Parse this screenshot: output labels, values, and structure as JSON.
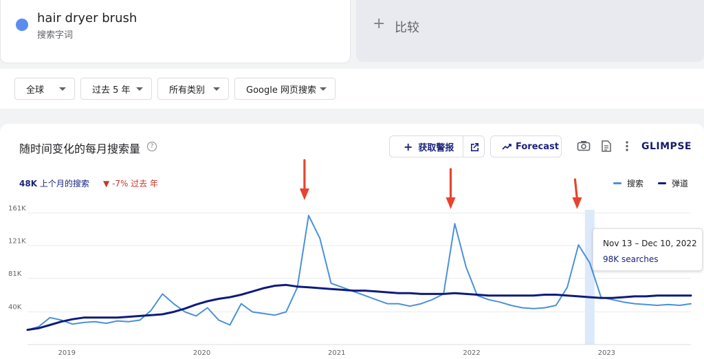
{
  "term": {
    "name": "hair dryer brush",
    "type": "搜索字词"
  },
  "compare": {
    "label": "比较"
  },
  "filters": [
    {
      "label": "全球"
    },
    {
      "label": "过去 5 年"
    },
    {
      "label": "所有类别"
    },
    {
      "label": "Google 网页搜索"
    }
  ],
  "chart_header": {
    "title": "随时间变化的每月搜索量",
    "alert_button": "获取警报",
    "forecast_button": "Forecast",
    "brand": "GLIMPSE"
  },
  "summary": {
    "value": "48K",
    "value_label": "上个月的搜索",
    "change": "-7% 过去 年"
  },
  "tooltip": {
    "date_range": "Nov 13 – Dec 10, 2022",
    "value": "98K searches"
  },
  "colors": {
    "search": "#4a90d9",
    "trend": "#0d1b7e",
    "highlight": "#dce9fb",
    "arrow": "#e8432f"
  },
  "chart_data": {
    "type": "line",
    "x": [
      "2018-10",
      "2018-11",
      "2018-12",
      "2019-01",
      "2019-02",
      "2019-03",
      "2019-04",
      "2019-05",
      "2019-06",
      "2019-07",
      "2019-08",
      "2019-09",
      "2019-10",
      "2019-11",
      "2019-12",
      "2020-01",
      "2020-02",
      "2020-03",
      "2020-04",
      "2020-05",
      "2020-06",
      "2020-07",
      "2020-08",
      "2020-09",
      "2020-10",
      "2020-11",
      "2020-12",
      "2021-01",
      "2021-02",
      "2021-03",
      "2021-04",
      "2021-05",
      "2021-06",
      "2021-07",
      "2021-08",
      "2021-09",
      "2021-10",
      "2021-11",
      "2021-12",
      "2022-01",
      "2022-02",
      "2022-03",
      "2022-04",
      "2022-05",
      "2022-06",
      "2022-07",
      "2022-08",
      "2022-09",
      "2022-10",
      "2022-11",
      "2022-12",
      "2023-01",
      "2023-02",
      "2023-03",
      "2023-04",
      "2023-05",
      "2023-06",
      "2023-07",
      "2023-08",
      "2023-09"
    ],
    "series": [
      {
        "name": "搜索",
        "values": [
          18,
          22,
          33,
          30,
          25,
          27,
          28,
          26,
          29,
          28,
          30,
          42,
          62,
          50,
          40,
          35,
          45,
          30,
          24,
          50,
          40,
          38,
          36,
          40,
          70,
          158,
          130,
          75,
          70,
          65,
          60,
          55,
          50,
          50,
          47,
          50,
          55,
          62,
          148,
          95,
          60,
          55,
          52,
          48,
          45,
          44,
          45,
          48,
          70,
          122,
          100,
          58,
          55,
          52,
          50,
          49,
          48,
          49,
          48,
          50
        ]
      },
      {
        "name": "弹道",
        "values": [
          18,
          20,
          24,
          28,
          31,
          33,
          33,
          33,
          33,
          34,
          35,
          36,
          37,
          40,
          44,
          49,
          53,
          56,
          58,
          61,
          65,
          69,
          72,
          73,
          71,
          70,
          69,
          68,
          67,
          66,
          66,
          65,
          64,
          63,
          63,
          62,
          62,
          62,
          63,
          62,
          61,
          60,
          60,
          60,
          60,
          60,
          61,
          61,
          60,
          59,
          58,
          57,
          57,
          58,
          59,
          59,
          60,
          60,
          60,
          60
        ]
      }
    ],
    "yticks": [
      "40K",
      "81K",
      "121K",
      "161K"
    ],
    "ytick_values": [
      40,
      81,
      121,
      161
    ],
    "xticks": [
      "2019",
      "2020",
      "2021",
      "2022",
      "2023"
    ],
    "ylim": [
      0,
      165
    ],
    "legend": [
      "搜索",
      "弹道"
    ],
    "grid": true,
    "highlight_period": "2022-12"
  }
}
